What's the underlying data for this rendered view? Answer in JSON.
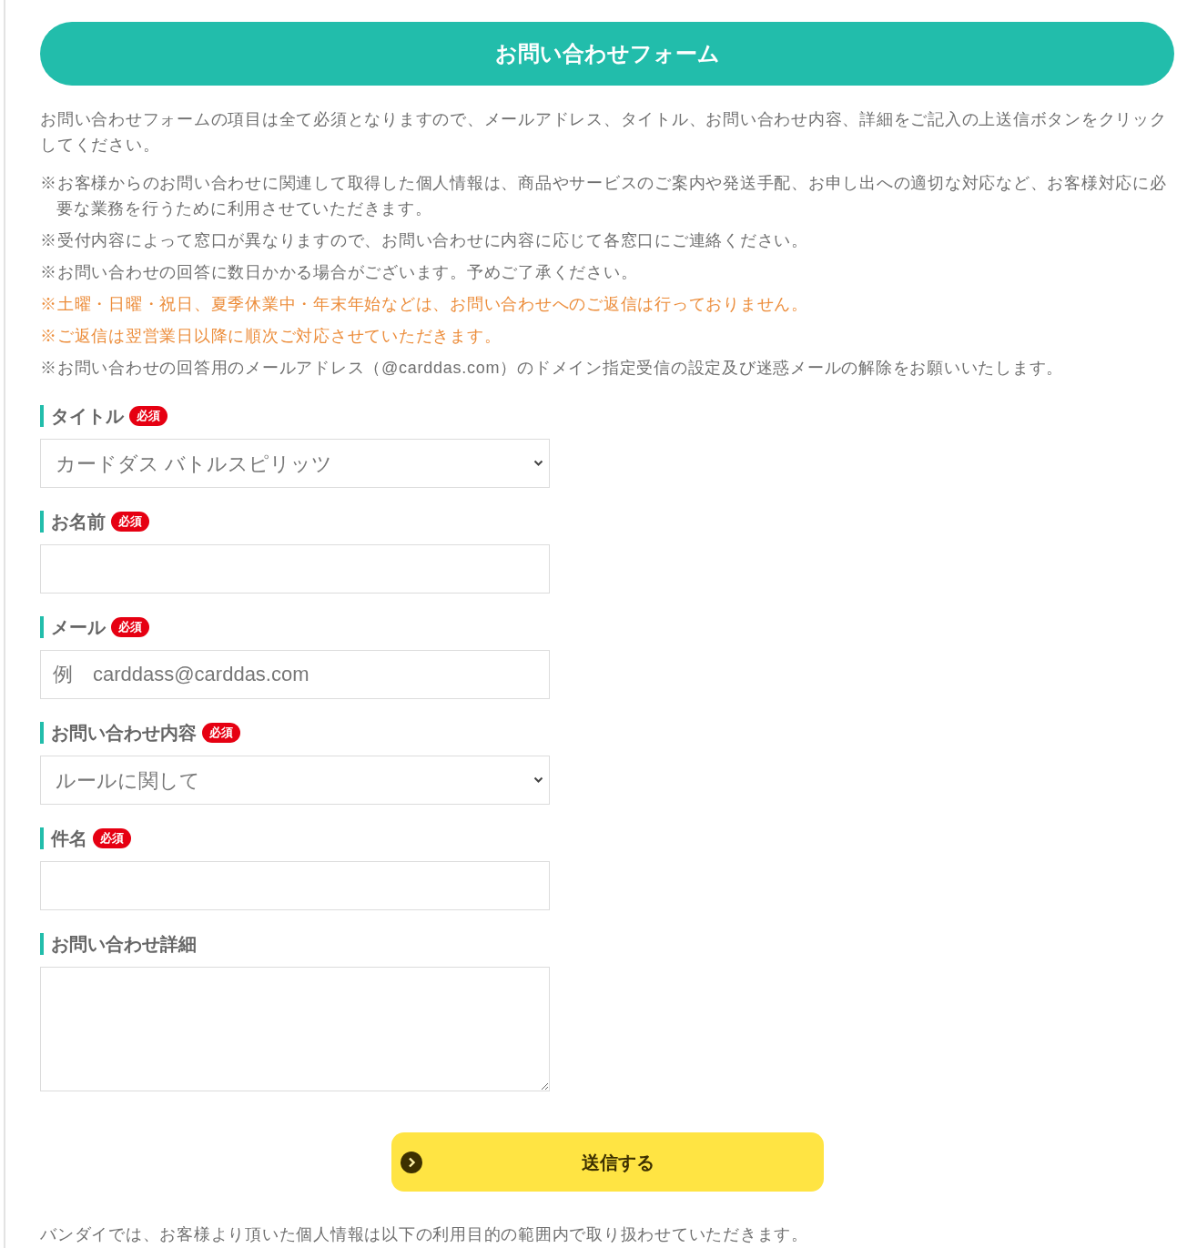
{
  "header": {
    "title": "お問い合わせフォーム"
  },
  "intro": "お問い合わせフォームの項目は全て必須となりますので、メールアドレス、タイトル、お問い合わせ内容、詳細をご記入の上送信ボタンをクリックしてください。",
  "notes": [
    {
      "text": "※お客様からのお問い合わせに関連して取得した個人情報は、商品やサービスのご案内や発送手配、お申し出への適切な対応など、お客様対応に必要な業務を行うために利用させていただきます。",
      "highlighted": false
    },
    {
      "text": "※受付内容によって窓口が異なりますので、お問い合わせに内容に応じて各窓口にご連絡ください。",
      "highlighted": false
    },
    {
      "text": "※お問い合わせの回答に数日かかる場合がございます。予めご了承ください。",
      "highlighted": false
    },
    {
      "text": "※土曜・日曜・祝日、夏季休業中・年末年始などは、お問い合わせへのご返信は行っておりません。",
      "highlighted": true
    },
    {
      "text": "※ご返信は翌営業日以降に順次ご対応させていただきます。",
      "highlighted": true
    },
    {
      "text": "※お問い合わせの回答用のメールアドレス（@carddas.com）のドメイン指定受信の設定及び迷惑メールの解除をお願いいたします。",
      "highlighted": false
    }
  ],
  "fields": [
    {
      "kind": "select",
      "label": "タイトル",
      "badge": "必須",
      "value": "カードダス バトルスピリッツ"
    },
    {
      "kind": "input",
      "label": "お名前",
      "badge": "必須"
    },
    {
      "kind": "input",
      "label": "メール",
      "badge": "必須",
      "placeholder": "例　carddass@carddas.com"
    },
    {
      "kind": "select",
      "label": "お問い合わせ内容",
      "badge": "必須",
      "value": "ルールに関して"
    },
    {
      "kind": "input",
      "label": "件名",
      "badge": "必須"
    },
    {
      "kind": "textarea",
      "label": "お問い合わせ詳細"
    }
  ],
  "submit": {
    "label": "送信する"
  },
  "footer_text": "バンダイでは、お客様より頂いた個人情報は以下の利用目的の範囲内で取り扱わせていただきます。"
}
